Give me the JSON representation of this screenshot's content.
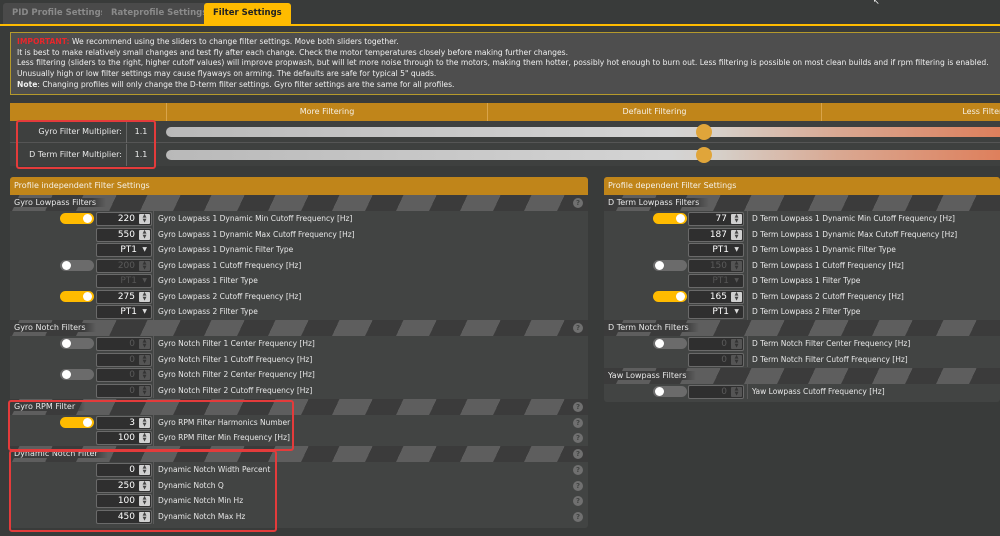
{
  "tabs": [
    {
      "label": "PID Profile Settings",
      "active": false
    },
    {
      "label": "Rateprofile Settings",
      "active": false
    },
    {
      "label": "Filter Settings",
      "active": true
    }
  ],
  "notice": {
    "important_label": "IMPORTANT:",
    "line1": " We recommend using the sliders to change filter settings. Move both sliders together.",
    "line2": "It is best to make relatively small changes and test fly after each change. Check the motor temperatures closely before making further changes.",
    "line3": "Less filtering (sliders to the right, higher cutoff values) will improve propwash, but will let more noise through to the motors, making them hotter, possibly hot enough to burn out. Less filtering is possible on most clean builds and if rpm filtering is enabled.",
    "line4": "Unusually high or low filter settings may cause flyaways on arming. The defaults are safe for typical 5\" quads.",
    "note_label": "Note",
    "line5": ": Changing profiles will only change the D-term filter settings. Gyro filter settings are the same for all profiles."
  },
  "multipliers": {
    "header": [
      "More Filtering",
      "Default Filtering",
      "Less Filtering"
    ],
    "rows": [
      {
        "label": "Gyro Filter Multiplier:",
        "value": "1.1",
        "slider_fraction": 0.64
      },
      {
        "label": "D Term Filter Multiplier:",
        "value": "1.1",
        "slider_fraction": 0.64
      }
    ]
  },
  "left_panel": {
    "title": "Profile independent Filter Settings",
    "sections": [
      {
        "title": "Gyro Lowpass Filters",
        "rows": [
          {
            "toggle": "on",
            "type": "num",
            "value": "220",
            "disabled": false,
            "label": "Gyro Lowpass 1 Dynamic Min Cutoff Frequency [Hz]"
          },
          {
            "toggle": null,
            "type": "num",
            "value": "550",
            "disabled": false,
            "label": "Gyro Lowpass 1 Dynamic Max Cutoff Frequency [Hz]"
          },
          {
            "toggle": null,
            "type": "sel",
            "value": "PT1",
            "disabled": false,
            "label": "Gyro Lowpass 1 Dynamic Filter Type"
          },
          {
            "toggle": "off",
            "type": "num",
            "value": "200",
            "disabled": true,
            "label": "Gyro Lowpass 1 Cutoff Frequency [Hz]"
          },
          {
            "toggle": null,
            "type": "sel",
            "value": "PT1",
            "disabled": true,
            "label": "Gyro Lowpass 1 Filter Type"
          },
          {
            "toggle": "on",
            "type": "num",
            "value": "275",
            "disabled": false,
            "label": "Gyro Lowpass 2 Cutoff Frequency [Hz]"
          },
          {
            "toggle": null,
            "type": "sel",
            "value": "PT1",
            "disabled": false,
            "label": "Gyro Lowpass 2 Filter Type"
          }
        ]
      },
      {
        "title": "Gyro Notch Filters",
        "rows": [
          {
            "toggle": "off",
            "type": "num",
            "value": "0",
            "disabled": true,
            "label": "Gyro Notch Filter 1 Center Frequency [Hz]"
          },
          {
            "toggle": null,
            "type": "num",
            "value": "0",
            "disabled": true,
            "label": "Gyro Notch Filter 1 Cutoff Frequency [Hz]"
          },
          {
            "toggle": "off",
            "type": "num",
            "value": "0",
            "disabled": true,
            "label": "Gyro Notch Filter 2 Center Frequency [Hz]"
          },
          {
            "toggle": null,
            "type": "num",
            "value": "0",
            "disabled": true,
            "label": "Gyro Notch Filter 2 Cutoff Frequency [Hz]"
          }
        ]
      },
      {
        "title": "Gyro RPM Filter",
        "rows": [
          {
            "toggle": "on",
            "type": "num",
            "value": "3",
            "disabled": false,
            "label": "Gyro RPM Filter Harmonics Number"
          },
          {
            "toggle": null,
            "type": "num",
            "value": "100",
            "disabled": false,
            "label": "Gyro RPM Filter Min Frequency [Hz]"
          }
        ]
      },
      {
        "title": "Dynamic Notch Filter",
        "rows": [
          {
            "toggle": null,
            "type": "num",
            "value": "0",
            "disabled": false,
            "label": "Dynamic Notch Width Percent"
          },
          {
            "toggle": null,
            "type": "num",
            "value": "250",
            "disabled": false,
            "label": "Dynamic Notch Q"
          },
          {
            "toggle": null,
            "type": "num",
            "value": "100",
            "disabled": false,
            "label": "Dynamic Notch Min Hz"
          },
          {
            "toggle": null,
            "type": "num",
            "value": "450",
            "disabled": false,
            "label": "Dynamic Notch Max Hz"
          }
        ]
      }
    ]
  },
  "right_panel": {
    "title": "Profile dependent Filter Settings",
    "sections": [
      {
        "title": "D Term Lowpass Filters",
        "rows": [
          {
            "toggle": "on",
            "type": "num",
            "value": "77",
            "disabled": false,
            "label": "D Term Lowpass 1 Dynamic Min Cutoff Frequency [Hz]"
          },
          {
            "toggle": null,
            "type": "num",
            "value": "187",
            "disabled": false,
            "label": "D Term Lowpass 1 Dynamic Max Cutoff Frequency [Hz]"
          },
          {
            "toggle": null,
            "type": "sel",
            "value": "PT1",
            "disabled": false,
            "label": "D Term Lowpass 1 Dynamic Filter Type"
          },
          {
            "toggle": "off",
            "type": "num",
            "value": "150",
            "disabled": true,
            "label": "D Term Lowpass 1 Cutoff Frequency [Hz]"
          },
          {
            "toggle": null,
            "type": "sel",
            "value": "PT1",
            "disabled": true,
            "label": "D Term Lowpass 1 Filter Type"
          },
          {
            "toggle": "on",
            "type": "num",
            "value": "165",
            "disabled": false,
            "label": "D Term Lowpass 2 Cutoff Frequency [Hz]"
          },
          {
            "toggle": null,
            "type": "sel",
            "value": "PT1",
            "disabled": false,
            "label": "D Term Lowpass 2 Filter Type"
          }
        ]
      },
      {
        "title": "D Term Notch Filters",
        "rows": [
          {
            "toggle": "off",
            "type": "num",
            "value": "0",
            "disabled": true,
            "label": "D Term Notch Filter Center Frequency [Hz]"
          },
          {
            "toggle": null,
            "type": "num",
            "value": "0",
            "disabled": true,
            "label": "D Term Notch Filter Cutoff Frequency [Hz]"
          }
        ]
      },
      {
        "title": "Yaw Lowpass Filters",
        "rows": [
          {
            "toggle": "off",
            "type": "num",
            "value": "0",
            "disabled": true,
            "label": "Yaw Lowpass Cutoff Frequency [Hz]"
          }
        ]
      }
    ]
  },
  "icons": {
    "help": "?",
    "spin": "▲▼",
    "dropdown": "▼"
  }
}
